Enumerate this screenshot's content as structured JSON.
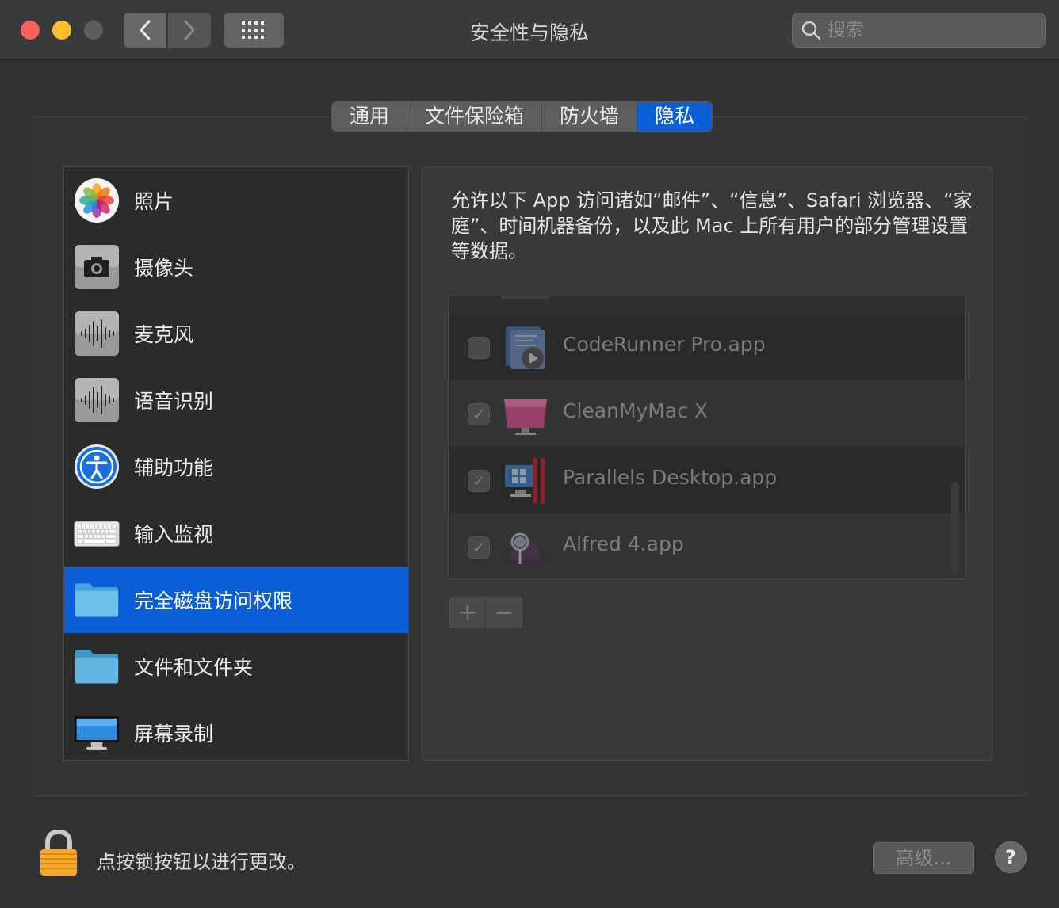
{
  "window": {
    "title": "安全性与隐私"
  },
  "search": {
    "placeholder": "搜索",
    "value": ""
  },
  "tabs": [
    {
      "label": "通用",
      "active": false
    },
    {
      "label": "文件保险箱",
      "active": false
    },
    {
      "label": "防火墙",
      "active": false
    },
    {
      "label": "隐私",
      "active": true
    }
  ],
  "sidebar": {
    "items": [
      {
        "label": "照片",
        "icon": "photos-icon",
        "selected": false
      },
      {
        "label": "摄像头",
        "icon": "camera-icon",
        "selected": false
      },
      {
        "label": "麦克风",
        "icon": "microphone-icon",
        "selected": false
      },
      {
        "label": "语音识别",
        "icon": "speech-recognition-icon",
        "selected": false
      },
      {
        "label": "辅助功能",
        "icon": "accessibility-icon",
        "selected": false
      },
      {
        "label": "输入监视",
        "icon": "keyboard-icon",
        "selected": false
      },
      {
        "label": "完全磁盘访问权限",
        "icon": "folder-icon",
        "selected": true
      },
      {
        "label": "文件和文件夹",
        "icon": "folder-icon",
        "selected": false
      },
      {
        "label": "屏幕录制",
        "icon": "display-icon",
        "selected": false
      }
    ]
  },
  "main": {
    "description": "允许以下 App 访问诸如“邮件”、“信息”、Safari 浏览器、“家庭”、时间机器备份，以及此 Mac 上所有用户的部分管理设置等数据。",
    "apps": [
      {
        "name": "CodeRunner Pro.app",
        "checked": false,
        "icon": "coderunner-icon"
      },
      {
        "name": "CleanMyMac X",
        "checked": true,
        "icon": "cleanmymac-icon"
      },
      {
        "name": "Parallels Desktop.app",
        "checked": true,
        "icon": "parallels-icon"
      },
      {
        "name": "Alfred 4.app",
        "checked": true,
        "icon": "alfred-icon"
      }
    ],
    "add_label": "+",
    "remove_label": "−"
  },
  "footer": {
    "lock_text": "点按锁按钮以进行更改。",
    "advanced_label": "高级...",
    "help_label": "?"
  },
  "colors": {
    "accent": "#0a5fd6",
    "close": "#fe5f57",
    "minimize": "#febc2e"
  }
}
